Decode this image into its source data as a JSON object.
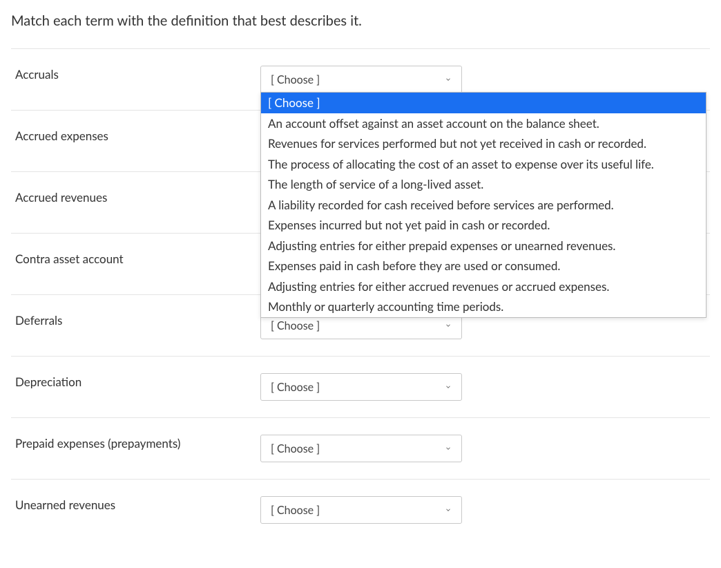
{
  "prompt": "Match each term with the definition that best describes it.",
  "choose_placeholder": "[ Choose ]",
  "terms": [
    {
      "label": "Accruals",
      "has_open_dropdown": true
    },
    {
      "label": "Accrued expenses"
    },
    {
      "label": "Accrued revenues"
    },
    {
      "label": "Contra asset account"
    },
    {
      "label": "Deferrals"
    },
    {
      "label": "Depreciation"
    },
    {
      "label": "Prepaid expenses (prepayments)"
    },
    {
      "label": "Unearned revenues"
    }
  ],
  "dropdown_options": [
    "[ Choose ]",
    "An account offset against an asset account on the balance sheet.",
    "Revenues for services performed but not yet received in cash or recorded.",
    "The process of allocating the cost of an asset to expense over its useful life.",
    "The length of service of a long-lived asset.",
    "A liability recorded for cash received before services are performed.",
    "Expenses incurred but not yet paid in cash or recorded.",
    "Adjusting entries for either prepaid expenses or unearned revenues.",
    "Expenses paid in cash before they are used or consumed.",
    "Adjusting entries for either accrued revenues or accrued expenses.",
    "Monthly or quarterly accounting time periods."
  ],
  "highlighted_option_index": 0,
  "dropdown_covers_rows": [
    1,
    2,
    3
  ]
}
